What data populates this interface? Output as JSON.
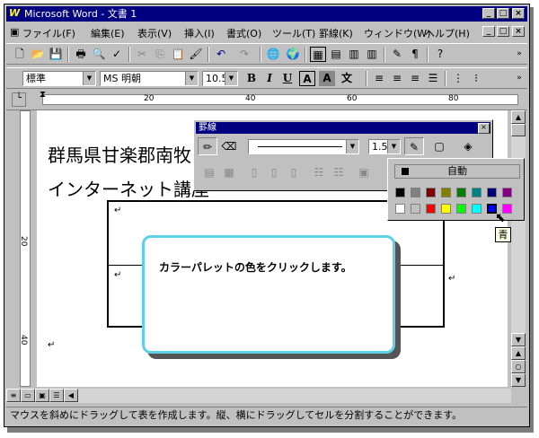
{
  "window": {
    "app_icon": "W",
    "title": "Microsoft Word - 文書 1"
  },
  "menu": [
    "ファイル(F)",
    "編集(E)",
    "表示(V)",
    "挿入(I)",
    "書式(O)",
    "ツール(T)",
    "罫線(K)",
    "ウィンドウ(W)",
    "ヘルプ(H)"
  ],
  "format_bar": {
    "style": "標準",
    "font": "MS 明朝",
    "size": "10.5",
    "bold": "B",
    "italic": "I",
    "underline": "U"
  },
  "ruler": {
    "marks": [
      "20",
      "40",
      "60",
      "80"
    ]
  },
  "vruler": {
    "marks": [
      "20",
      "40"
    ]
  },
  "document": {
    "line1": "群馬県甘楽郡南牧",
    "line2": "インターネット講座",
    "return_mark": "↵"
  },
  "borders_toolbar": {
    "title": "罫線",
    "line_weight": "1.5"
  },
  "color_palette": {
    "auto_label": "自動",
    "colors_row1": [
      "#000000",
      "#808080",
      "#800000",
      "#808000",
      "#008000",
      "#008080",
      "#000080",
      "#800080"
    ],
    "colors_row2": [
      "#ffffff",
      "#c0c0c0",
      "#ff0000",
      "#ffff00",
      "#00ff00",
      "#00ffff",
      "#0000ff",
      "#ff00ff"
    ],
    "tooltip": "青"
  },
  "callout": {
    "text": "カラーパレットの色をクリックします。"
  },
  "status_bar": {
    "text": "マウスを斜めにドラッグして表を作成します。縦、横にドラッグしてセルを分割することができます。"
  }
}
